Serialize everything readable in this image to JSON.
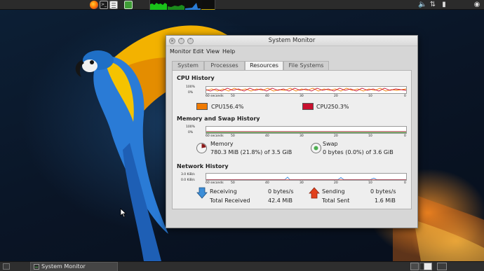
{
  "window": {
    "title": "System Monitor",
    "menu": [
      "Monitor",
      "Edit",
      "View",
      "Help"
    ],
    "tabs": [
      "System",
      "Processes",
      "Resources",
      "File Systems"
    ],
    "active_tab": "Resources"
  },
  "resources": {
    "cpu": {
      "title": "CPU History",
      "y_max": "100%",
      "y_min": "0%",
      "cpu1_label": "CPU1",
      "cpu1_value": "56.4%",
      "cpu1_color": "#f07a00",
      "cpu2_label": "CPU2",
      "cpu2_value": "50.3%",
      "cpu2_color": "#c8102e"
    },
    "memory": {
      "title": "Memory and Swap History",
      "y_max": "100%",
      "y_min": "0%",
      "memory_label": "Memory",
      "memory_value": "780.3 MiB (21.8%) of 3.5 GiB",
      "memory_color": "#8b1a1a",
      "memory_fraction": 0.218,
      "swap_label": "Swap",
      "swap_value": "0 bytes (0.0%) of 3.6 GiB",
      "swap_color": "#4caf50"
    },
    "network": {
      "title": "Network History",
      "y_max": "3.0 KiB/s",
      "y_min": "0.0 KiB/s",
      "receiving_label": "Receiving",
      "receiving_value": "0 bytes/s",
      "total_received_label": "Total Received",
      "total_received_value": "42.4 MiB",
      "sending_label": "Sending",
      "sending_value": "0 bytes/s",
      "total_sent_label": "Total Sent",
      "total_sent_value": "1.6 MiB"
    },
    "time_axis": [
      "60 seconds",
      "50",
      "40",
      "30",
      "20",
      "10",
      "0"
    ]
  },
  "taskbar": {
    "task_label": "System Monitor"
  }
}
